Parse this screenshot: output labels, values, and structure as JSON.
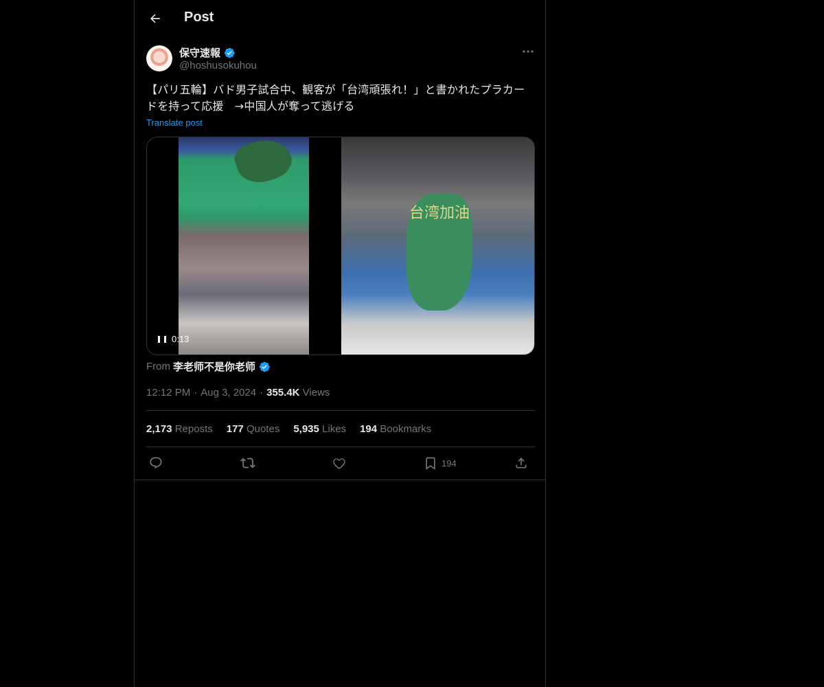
{
  "header": {
    "title": "Post"
  },
  "author": {
    "display_name": "保守速報",
    "handle": "@hoshusokuhou",
    "verified": true
  },
  "post": {
    "text": "【パリ五輪】バド男子試合中、観客が「台湾頑張れ！」と書かれたプラカードを持って応援　→中国人が奪って逃げる",
    "translate_label": "Translate post"
  },
  "media": {
    "timecode": "0:13",
    "placard_text": "台湾加油"
  },
  "attribution": {
    "from_label": "From",
    "from_name": "李老师不是你老师",
    "verified": true
  },
  "meta": {
    "time": "12:12 PM",
    "separator": "·",
    "date": "Aug 3, 2024",
    "views_count": "355.4K",
    "views_label": "Views"
  },
  "stats": {
    "reposts_count": "2,173",
    "reposts_label": "Reposts",
    "quotes_count": "177",
    "quotes_label": "Quotes",
    "likes_count": "5,935",
    "likes_label": "Likes",
    "bookmarks_count": "194",
    "bookmarks_label": "Bookmarks"
  },
  "actions": {
    "bookmark_count": "194"
  },
  "colors": {
    "background": "#000000",
    "text_primary": "#e7e9ea",
    "text_secondary": "#71767b",
    "accent": "#1d9bf0",
    "border": "#2f3336"
  },
  "icons": [
    "back-arrow-icon",
    "verified-badge-icon",
    "more-icon",
    "pause-icon",
    "reply-icon",
    "repost-icon",
    "like-icon",
    "bookmark-icon",
    "share-icon"
  ]
}
